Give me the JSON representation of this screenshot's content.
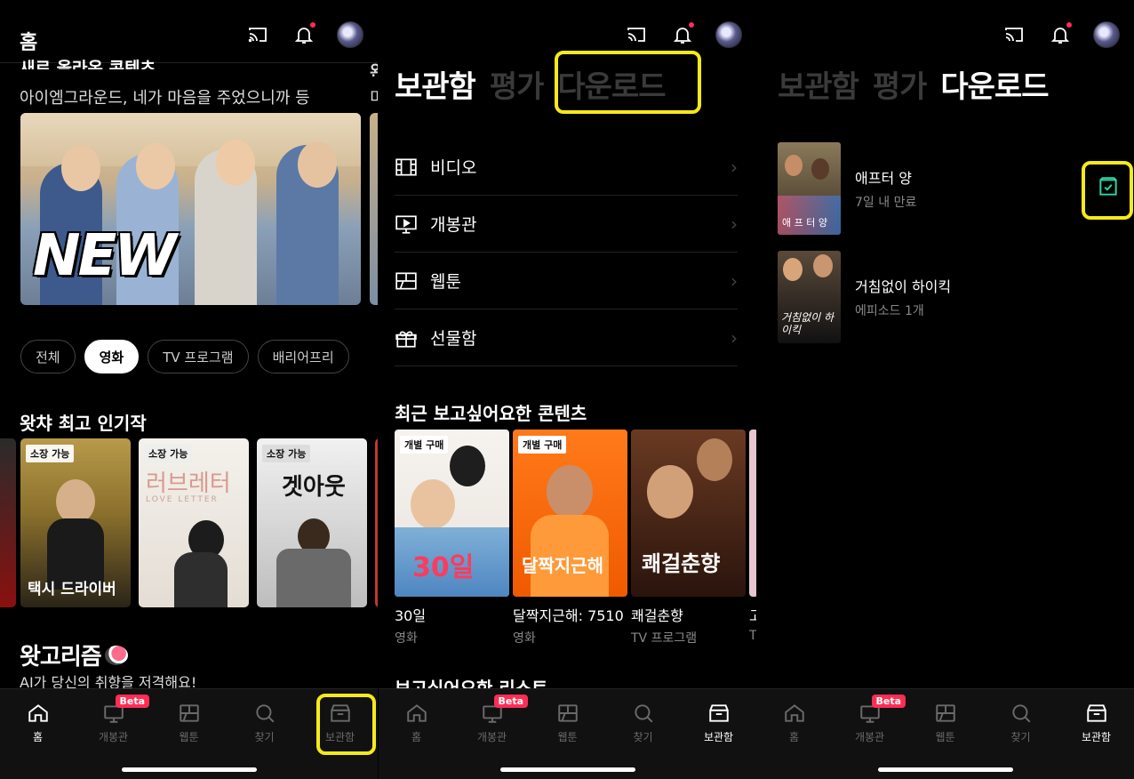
{
  "top_icons": [
    "cast-icon",
    "bell-icon",
    "avatar"
  ],
  "home": {
    "title": "홈",
    "section_heading": "새로 올라온 콘텐츠",
    "section_sub": "아이엠그라운드, 네가 마음을 주었으니까 등",
    "peek_heading": "완",
    "peek_sub": "미",
    "banner_text": "NEW",
    "chips": [
      "전체",
      "영화",
      "TV 프로그램",
      "배리어프리"
    ],
    "active_chip": "영화",
    "popular_title": "왓챠 최고 인기작",
    "posters": [
      {
        "tag": "소장 가능",
        "title": "택시 드라이버"
      },
      {
        "tag": "소장 가능",
        "title": "러브레터",
        "subtitle": "LOVE LETTER"
      },
      {
        "tag": "소장 가능",
        "title": "겟아웃"
      }
    ],
    "rec_title": "왓고리즘",
    "rec_sub": "AI가 당신의 취향을 저격해요!"
  },
  "library": {
    "tabs": [
      "보관함",
      "평가",
      "다운로드"
    ],
    "menu": [
      {
        "icon": "film-icon",
        "label": "비디오"
      },
      {
        "icon": "screen-play-icon",
        "label": "개봉관"
      },
      {
        "icon": "webtoon-icon",
        "label": "웹툰"
      },
      {
        "icon": "gift-icon",
        "label": "선물함"
      }
    ],
    "wish_title": "최근 보고싶어요한 콘텐츠",
    "wish_items": [
      {
        "tag": "개별 구매",
        "poster_text": "30일",
        "name": "30일",
        "type": "영화"
      },
      {
        "tag": "개별 구매",
        "poster_text": "달짝지근해",
        "name": "달짝지근해: 7510",
        "type": "영화"
      },
      {
        "tag": "",
        "poster_text": "쾌걸춘향",
        "name": "쾌걸춘향",
        "type": "TV 프로그램"
      }
    ],
    "peek_name": "고",
    "peek_type": "T",
    "wish_list_title": "보고싶어요한 리스트"
  },
  "downloads": {
    "items": [
      {
        "name": "애프터 양",
        "meta": "7일 내 만료",
        "poster_text": "애 프 터  양"
      },
      {
        "name": "거침없이 하이킥",
        "meta": "에피소드 1개",
        "poster_text": "거침없이 하이킥"
      }
    ]
  },
  "bottom_nav": [
    {
      "label": "홈",
      "icon": "home-icon"
    },
    {
      "label": "개봉관",
      "icon": "theater-icon",
      "badge": "Beta"
    },
    {
      "label": "웹툰",
      "icon": "webtoon-icon"
    },
    {
      "label": "찾기",
      "icon": "search-icon"
    },
    {
      "label": "보관함",
      "icon": "archive-icon"
    }
  ],
  "colors": {
    "highlight": "#f6ea19",
    "beta": "#ff2d55",
    "accent_green": "#2bd6a6"
  }
}
